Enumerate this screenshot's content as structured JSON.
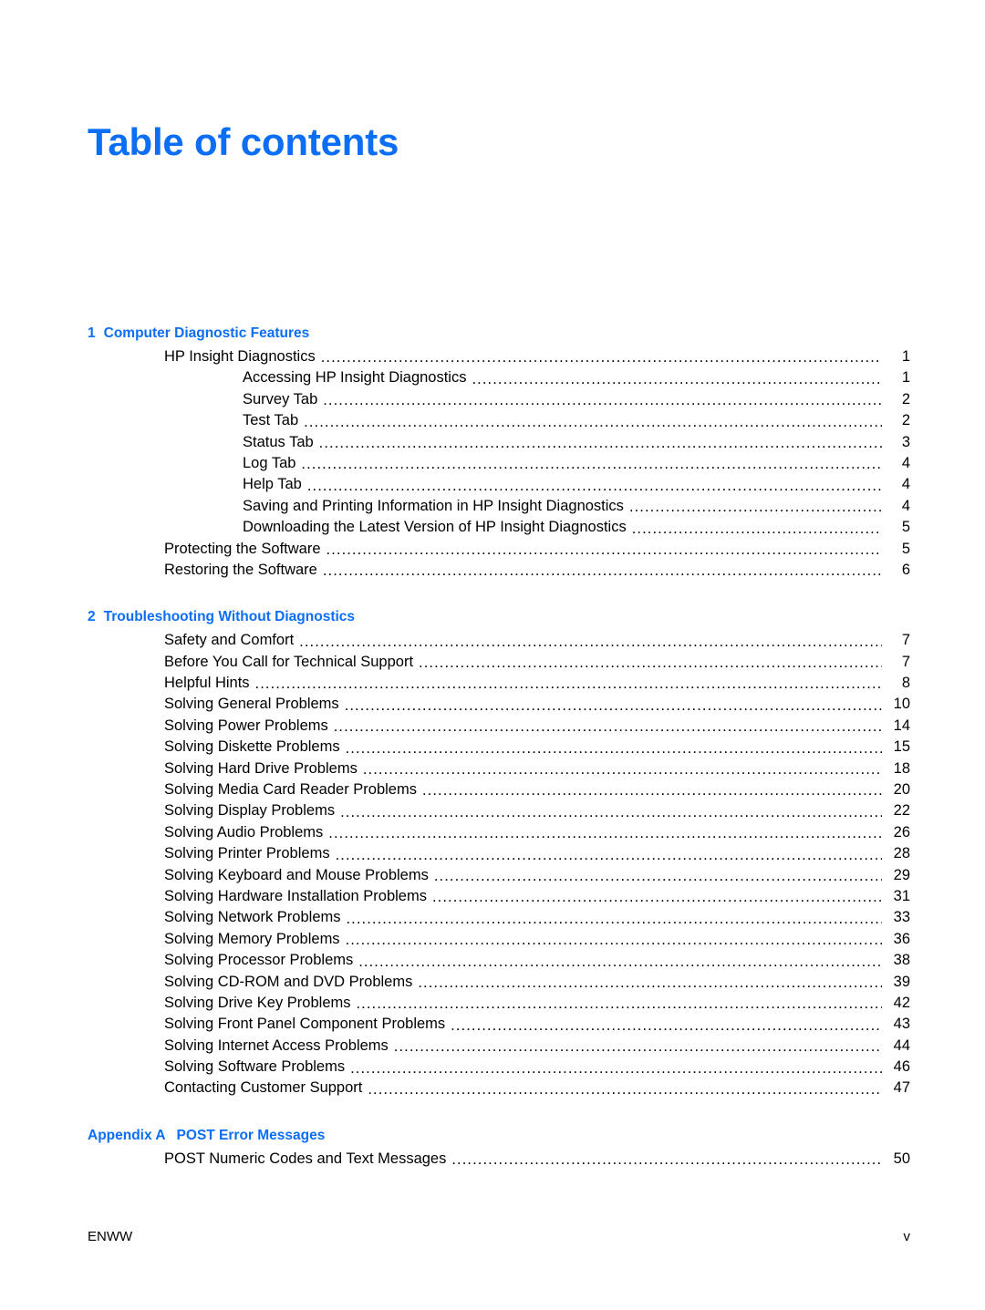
{
  "document": {
    "title": "Table of contents"
  },
  "toc": {
    "sections": [
      {
        "number": "1",
        "number_kind": "chapter",
        "title": "Computer Diagnostic Features",
        "entries": [
          {
            "level": 1,
            "label": "HP Insight Diagnostics",
            "page": "1"
          },
          {
            "level": 2,
            "label": "Accessing HP Insight Diagnostics",
            "page": "1"
          },
          {
            "level": 2,
            "label": "Survey Tab",
            "page": "2"
          },
          {
            "level": 2,
            "label": "Test Tab",
            "page": "2"
          },
          {
            "level": 2,
            "label": "Status Tab",
            "page": "3"
          },
          {
            "level": 2,
            "label": "Log Tab",
            "page": "4"
          },
          {
            "level": 2,
            "label": "Help Tab",
            "page": "4"
          },
          {
            "level": 2,
            "label": "Saving and Printing Information in HP Insight Diagnostics",
            "page": "4"
          },
          {
            "level": 2,
            "label": "Downloading the Latest Version of HP Insight Diagnostics",
            "page": "5"
          },
          {
            "level": 1,
            "label": "Protecting the Software",
            "page": "5"
          },
          {
            "level": 1,
            "label": "Restoring the Software",
            "page": "6"
          }
        ]
      },
      {
        "number": "2",
        "number_kind": "chapter",
        "title": "Troubleshooting Without Diagnostics",
        "entries": [
          {
            "level": 1,
            "label": "Safety and Comfort",
            "page": "7"
          },
          {
            "level": 1,
            "label": "Before You Call for Technical Support",
            "page": "7"
          },
          {
            "level": 1,
            "label": "Helpful Hints",
            "page": "8"
          },
          {
            "level": 1,
            "label": "Solving General Problems",
            "page": "10"
          },
          {
            "level": 1,
            "label": "Solving Power Problems",
            "page": "14"
          },
          {
            "level": 1,
            "label": "Solving Diskette Problems",
            "page": "15"
          },
          {
            "level": 1,
            "label": "Solving Hard Drive Problems",
            "page": "18"
          },
          {
            "level": 1,
            "label": "Solving Media Card Reader Problems",
            "page": "20"
          },
          {
            "level": 1,
            "label": "Solving Display Problems",
            "page": "22"
          },
          {
            "level": 1,
            "label": "Solving Audio Problems",
            "page": "26"
          },
          {
            "level": 1,
            "label": "Solving Printer Problems",
            "page": "28"
          },
          {
            "level": 1,
            "label": "Solving Keyboard and Mouse Problems",
            "page": "29"
          },
          {
            "level": 1,
            "label": "Solving Hardware Installation Problems",
            "page": "31"
          },
          {
            "level": 1,
            "label": "Solving Network Problems",
            "page": "33"
          },
          {
            "level": 1,
            "label": "Solving Memory Problems",
            "page": "36"
          },
          {
            "level": 1,
            "label": "Solving Processor Problems",
            "page": "38"
          },
          {
            "level": 1,
            "label": "Solving CD-ROM and DVD Problems",
            "page": "39"
          },
          {
            "level": 1,
            "label": "Solving Drive Key Problems",
            "page": "42"
          },
          {
            "level": 1,
            "label": "Solving Front Panel Component Problems",
            "page": "43"
          },
          {
            "level": 1,
            "label": "Solving Internet Access Problems",
            "page": "44"
          },
          {
            "level": 1,
            "label": "Solving Software Problems",
            "page": "46"
          },
          {
            "level": 1,
            "label": "Contacting Customer Support",
            "page": "47"
          }
        ]
      },
      {
        "number": "Appendix A",
        "number_kind": "appendix",
        "title": "POST Error Messages",
        "entries": [
          {
            "level": 1,
            "label": "POST Numeric Codes and Text Messages",
            "page": "50"
          }
        ]
      }
    ]
  },
  "footer": {
    "left": "ENWW",
    "right": "v"
  },
  "colors": {
    "heading_blue": "#0b6ef5",
    "body_text": "#000000",
    "page_background": "#ffffff"
  }
}
